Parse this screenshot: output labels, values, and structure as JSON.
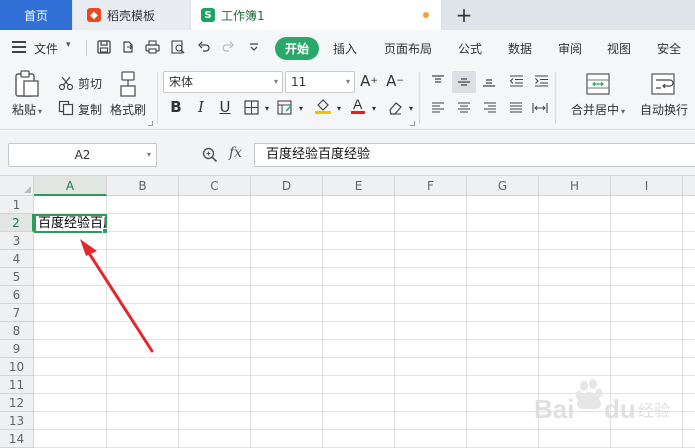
{
  "tabs": {
    "home": "首页",
    "templates": "稻壳模板",
    "workbook": "工作簿1",
    "new_tab": "+"
  },
  "menu": {
    "file": "文件",
    "ribbon_tabs": [
      "开始",
      "插入",
      "页面布局",
      "公式",
      "数据",
      "审阅",
      "视图",
      "安全"
    ],
    "active_tab": "开始"
  },
  "ribbon": {
    "paste": "粘贴",
    "cut": "剪切",
    "copy": "复制",
    "format_painter": "格式刷",
    "font_name": "宋体",
    "font_size": "11",
    "merge_center": "合并居中",
    "wrap_text": "自动换行",
    "font_color_hex": "#e02020",
    "fill_color_hex": "#f5c400"
  },
  "formula": {
    "name_box": "A2",
    "fx": "fx",
    "content": "百度经验百度经验"
  },
  "sheet": {
    "columns": [
      "A",
      "B",
      "C",
      "D",
      "E",
      "F",
      "G",
      "H",
      "I"
    ],
    "rows": [
      "1",
      "2",
      "3",
      "4",
      "5",
      "6",
      "7",
      "8",
      "9",
      "10",
      "11",
      "12",
      "13",
      "14"
    ],
    "selected_col": "A",
    "selected_row": "2",
    "cell_a2": "百度经验百度经验"
  },
  "colors": {
    "accent_green": "#2aa86a",
    "home_tab_blue": "#2f6fd6",
    "annotation_arrow": "#e0282e"
  },
  "watermark": "Baidu经验"
}
